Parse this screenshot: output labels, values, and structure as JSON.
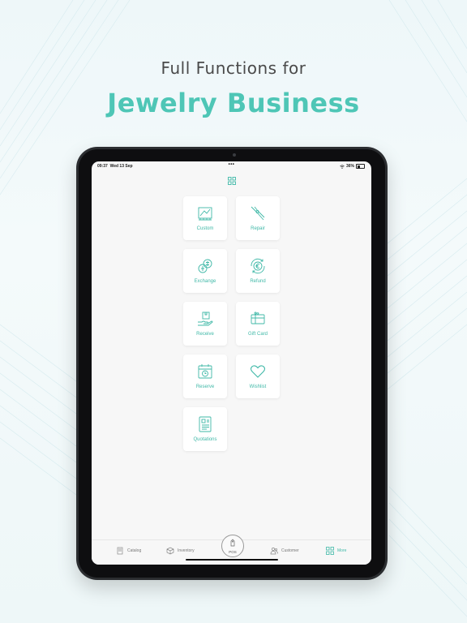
{
  "headline": {
    "line1": "Full Functions for",
    "line2": "Jewelry Business"
  },
  "colors": {
    "accent": "#4ec6b6",
    "tile_text": "#3fb8a7",
    "tablet_frame": "#2b2d30"
  },
  "status_bar": {
    "time": "09:37",
    "date": "Wed 13 Sep",
    "dots": "•••",
    "battery": "36%"
  },
  "toolbar": {
    "grid_icon": "grid-icon"
  },
  "functions": [
    {
      "label": "Custom",
      "icon": "ruler-sketch-icon"
    },
    {
      "label": "Repair",
      "icon": "pliers-icon"
    },
    {
      "label": "Exchange",
      "icon": "coins-exchange-icon"
    },
    {
      "label": "Refund",
      "icon": "euro-refund-icon"
    },
    {
      "label": "Receive",
      "icon": "hand-box-icon"
    },
    {
      "label": "Gift Card",
      "icon": "gift-card-icon"
    },
    {
      "label": "Reserve",
      "icon": "calendar-clock-icon"
    },
    {
      "label": "Wishlist",
      "icon": "heart-icon"
    },
    {
      "label": "Quotations",
      "icon": "document-icon"
    }
  ],
  "tabbar": {
    "catalog": "Catalog",
    "inventory": "Inventory",
    "pos": "POS",
    "customer": "Customer",
    "more": "More"
  }
}
